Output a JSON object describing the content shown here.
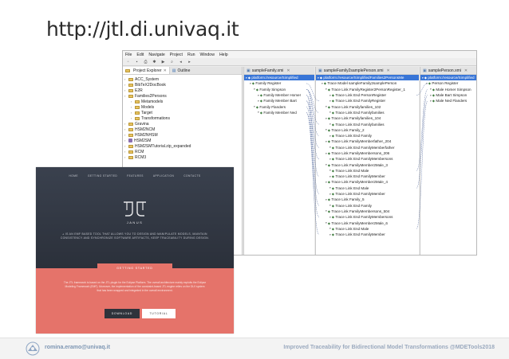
{
  "slide": {
    "title": "http://jtl.di.univaq.it",
    "footer_email": "romina.eramo@univaq.it",
    "footer_conference": "Improved Traceability for Bidirectional Model Transformations @MDETools2018"
  },
  "eclipse": {
    "menu": [
      "File",
      "Edit",
      "Navigate",
      "Project",
      "Run",
      "Window",
      "Help"
    ],
    "toolbar_icons": [
      "new-icon",
      "save-icon",
      "print-icon",
      "debug-icon",
      "run-icon",
      "search-icon",
      "back-icon",
      "forward-icon"
    ],
    "explorer_tabs": [
      "Project Explorer",
      "Outline"
    ],
    "explorer_items": [
      {
        "label": "ACC_System",
        "indent": 0,
        "kind": "folder"
      },
      {
        "label": "BibTeX2DocBook",
        "indent": 0,
        "kind": "folder"
      },
      {
        "label": "E2R",
        "indent": 0,
        "kind": "folder"
      },
      {
        "label": "Families2Persons",
        "indent": 0,
        "kind": "folder"
      },
      {
        "label": "Metamodels",
        "indent": 1,
        "kind": "folder"
      },
      {
        "label": "Models",
        "indent": 1,
        "kind": "folder"
      },
      {
        "label": "Target",
        "indent": 1,
        "kind": "folder"
      },
      {
        "label": "Transformations",
        "indent": 1,
        "kind": "folder"
      },
      {
        "label": "Gravina",
        "indent": 0,
        "kind": "folder"
      },
      {
        "label": "HSM2NCM",
        "indent": 0,
        "kind": "folder"
      },
      {
        "label": "HSM2NHSM",
        "indent": 0,
        "kind": "folder"
      },
      {
        "label": "HSM2SM",
        "indent": 0,
        "kind": "pkg"
      },
      {
        "label": "HSM2SMTutorial.zip_expanded",
        "indent": 0,
        "kind": "folder"
      },
      {
        "label": "RCM",
        "indent": 0,
        "kind": "folder"
      },
      {
        "label": "RCM3",
        "indent": 0,
        "kind": "folder"
      }
    ],
    "pane_family": {
      "tab": "sampleFamily.xmi",
      "rows": [
        {
          "label": "platform:/resource/Simplified",
          "indent": 0,
          "sel": true
        },
        {
          "label": "Family Register",
          "indent": 1
        },
        {
          "label": "Family Simpson",
          "indent": 2
        },
        {
          "label": "Family Member Homer",
          "indent": 3
        },
        {
          "label": "Family Member Bart",
          "indent": 3
        },
        {
          "label": "Family Flanders",
          "indent": 2
        },
        {
          "label": "Family Member Ned",
          "indent": 3
        }
      ]
    },
    "pane_trace": {
      "tab": "sampleFamily2samplePerson.xmi",
      "rows": [
        {
          "label": "platform:/resource/SimplifiedFamilies2PersonsMe",
          "indent": 0,
          "sel": true
        },
        {
          "label": "Trace Model sampleFamily2samplePerson",
          "indent": 1
        },
        {
          "label": "Trace Link FamilyRegister2PersonRegister_1",
          "indent": 2
        },
        {
          "label": "Trace Link End PersonRegister",
          "indent": 3
        },
        {
          "label": "Trace Link End FamilyRegister",
          "indent": 3
        },
        {
          "label": "Trace Link Familyfamilies_102",
          "indent": 2
        },
        {
          "label": "Trace Link End Familyfamilies",
          "indent": 3
        },
        {
          "label": "Trace Link Familyfamilies_104",
          "indent": 2
        },
        {
          "label": "Trace Link End Familyfamilies",
          "indent": 3
        },
        {
          "label": "Trace Link Family_2",
          "indent": 2
        },
        {
          "label": "Trace Link End Family",
          "indent": 3
        },
        {
          "label": "Trace Link FamilyMemberfather_204",
          "indent": 2
        },
        {
          "label": "Trace Link End FamilyMemberfather",
          "indent": 3
        },
        {
          "label": "Trace Link FamilyMembersons_206",
          "indent": 2
        },
        {
          "label": "Trace Link End FamilyMembersons",
          "indent": 3
        },
        {
          "label": "Trace Link FamilyMember2Male_3",
          "indent": 2
        },
        {
          "label": "Trace Link End Male",
          "indent": 3
        },
        {
          "label": "Trace Link End FamilyMember",
          "indent": 3
        },
        {
          "label": "Trace Link FamilyMember2Male_4",
          "indent": 2
        },
        {
          "label": "Trace Link End Male",
          "indent": 3
        },
        {
          "label": "Trace Link End FamilyMember",
          "indent": 3
        },
        {
          "label": "Trace Link Family_5",
          "indent": 2
        },
        {
          "label": "Trace Link End Family",
          "indent": 3
        },
        {
          "label": "Trace Link FamilyMembersons_504",
          "indent": 2
        },
        {
          "label": "Trace Link End FamilyMembersons",
          "indent": 3
        },
        {
          "label": "Trace Link FamilyMember2Male_6",
          "indent": 2
        },
        {
          "label": "Trace Link End Male",
          "indent": 3
        },
        {
          "label": "Trace Link End FamilyMember",
          "indent": 3
        }
      ]
    },
    "pane_person": {
      "tab": "samplePerson.xmi",
      "rows": [
        {
          "label": "platform:/resource/Simplified",
          "indent": 0,
          "sel": true
        },
        {
          "label": "Person Register",
          "indent": 1
        },
        {
          "label": "Male Homer Simpson",
          "indent": 2
        },
        {
          "label": "Male Bart Simpson",
          "indent": 2
        },
        {
          "label": "Male Ned Flanders",
          "indent": 2
        }
      ]
    }
  },
  "janus": {
    "nav": [
      "HOME",
      "GETTING STARTED",
      "FEATURES",
      "APPLICATION",
      "CONTACTS"
    ],
    "name": "JANUS",
    "tagline": "IS AN EMF BASED TOOL THAT ALLOWS YOU TO DESIGN AND MANIPULATE MODELS, MAINTAIN CONSISTENCY AND SYNCHRONIZE SOFTWARE ARTIFACTS, KEEP TRACEABILITY DURING DESIGN.",
    "getting_started": "GETTING STARTED",
    "description": "The JTL framework is based on the JTL plugin for the Eclipse Platform. The overall architecture mainly exploits the Eclipse Modeling Framework (EMF). Moreover, the implementation of the constraint-based JTL engine relies on the DLV system that has been wrapped and integrated in the overall environment.",
    "download": "DOWNLOAD",
    "tutorial": "TUTORIAL"
  }
}
